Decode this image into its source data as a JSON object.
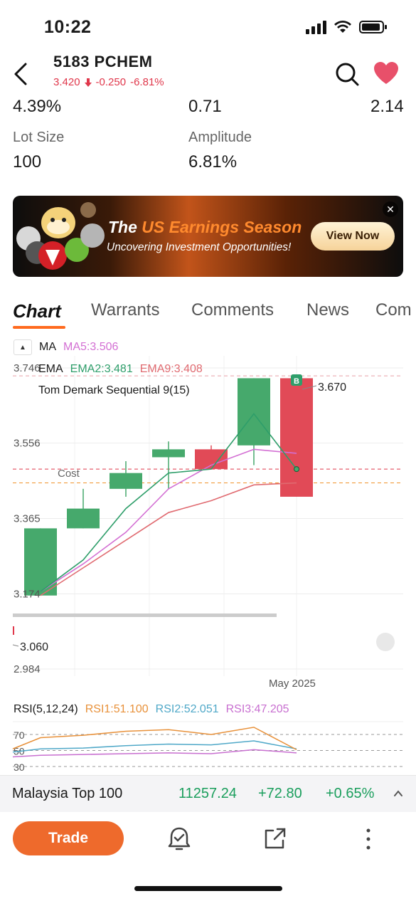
{
  "status_bar": {
    "time": "10:22"
  },
  "header": {
    "title": "5183  PCHEM",
    "price": "3.420",
    "change": "-0.250",
    "change_pct": "-6.81%",
    "colors": {
      "down": "#e0374b",
      "up": "#1a9e5c"
    }
  },
  "stats": {
    "row1": [
      "4.39%",
      "0.71",
      "2.14"
    ],
    "lot_size_label": "Lot Size",
    "lot_size_value": "100",
    "amplitude_label": "Amplitude",
    "amplitude_value": "6.81%"
  },
  "banner": {
    "title_prefix": "The ",
    "title_highlight": "US Earnings Season",
    "subtitle": "Uncovering Investment Opportunities!",
    "button_label": "View Now",
    "close_icon": "close-icon"
  },
  "tabs": [
    "Chart",
    "Warrants",
    "Comments",
    "News",
    "Com"
  ],
  "indicators": {
    "ma_label": "MA",
    "ma5": "MA5:3.506",
    "ema_label": "EMA",
    "ema2": "EMA2:3.481",
    "ema9": "EMA9:3.408",
    "td_label": "Tom Demark Sequential 9(15)",
    "cost_label": "Cost",
    "b_marker": "B",
    "high_label": "3.670",
    "low_label": "3.060",
    "x_label": "May 2025",
    "colors": {
      "ma5": "#d36fd3",
      "ema2": "#2e9e6a",
      "ema9": "#e06a70"
    }
  },
  "chart_data": {
    "type": "candlestick",
    "y_ticks": [
      "3.746",
      "3.556",
      "3.365",
      "3.174",
      "2.984"
    ],
    "ylim": [
      2.984,
      3.746
    ],
    "x_label": "May 2025",
    "candles": [
      {
        "open": 3.17,
        "close": 3.34,
        "high": 3.34,
        "low": 3.17,
        "dir": "up"
      },
      {
        "open": 3.34,
        "close": 3.39,
        "high": 3.44,
        "low": 3.34,
        "dir": "up"
      },
      {
        "open": 3.44,
        "close": 3.48,
        "high": 3.51,
        "low": 3.42,
        "dir": "up"
      },
      {
        "open": 3.52,
        "close": 3.54,
        "high": 3.56,
        "low": 3.44,
        "dir": "up"
      },
      {
        "open": 3.54,
        "close": 3.49,
        "high": 3.55,
        "low": 3.49,
        "dir": "down"
      },
      {
        "open": 3.55,
        "close": 3.72,
        "high": 3.72,
        "low": 3.5,
        "dir": "up"
      },
      {
        "open": 3.72,
        "close": 3.42,
        "high": 3.72,
        "low": 3.42,
        "dir": "down"
      }
    ],
    "ma5": [
      3.18,
      3.25,
      3.33,
      3.44,
      3.5,
      3.54,
      3.53
    ],
    "ema2": [
      3.18,
      3.26,
      3.39,
      3.48,
      3.49,
      3.63,
      3.49
    ],
    "ema9": [
      3.17,
      3.24,
      3.31,
      3.38,
      3.41,
      3.45,
      3.455
    ],
    "cost_line": 3.49,
    "dashed_top": 3.726,
    "dashed_bottom": 3.455
  },
  "rsi": {
    "label": "RSI(5,12,24)",
    "rsi1": "RSI1:51.100",
    "rsi2": "RSI2:52.051",
    "rsi3": "RSI3:47.205",
    "y_ticks": [
      "70",
      "50",
      "30"
    ],
    "colors": {
      "rsi1": "#e8913a",
      "rsi2": "#4fa8c8",
      "rsi3": "#c86fd0"
    },
    "series1": [
      52,
      66,
      69,
      74,
      76,
      70,
      79,
      51
    ],
    "series2": [
      48,
      52,
      53,
      56,
      58,
      57,
      62,
      52
    ],
    "series3": [
      42,
      44,
      45,
      46,
      47,
      46,
      51,
      47
    ]
  },
  "market_bar": {
    "name": "Malaysia Top 100",
    "value": "11257.24",
    "change": "+72.80",
    "change_pct": "+0.65%"
  },
  "footer": {
    "trade_label": "Trade"
  }
}
